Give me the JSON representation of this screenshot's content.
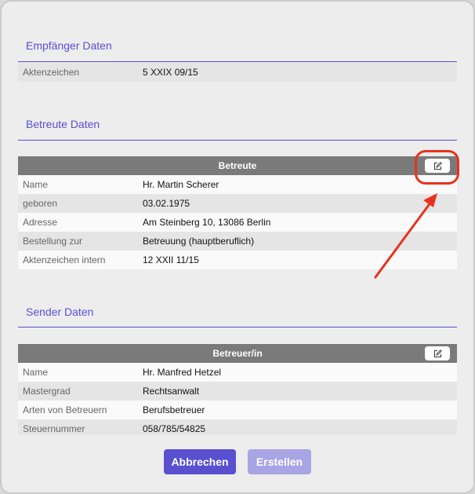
{
  "recipient": {
    "title": "Empfänger Daten",
    "rows": [
      {
        "label": "Aktenzeichen",
        "value": "5 XXIX 09/15"
      }
    ]
  },
  "ward": {
    "title": "Betreute Daten",
    "table_header": "Betreute",
    "rows": [
      {
        "label": "Name",
        "value": "Hr. Martin Scherer"
      },
      {
        "label": "geboren",
        "value": "03.02.1975"
      },
      {
        "label": "Adresse",
        "value": "Am Steinberg 10, 13086 Berlin"
      },
      {
        "label": "Bestellung zur",
        "value": "Betreuung (hauptberuflich)"
      },
      {
        "label": "Aktenzeichen intern",
        "value": "12 XXII 11/15"
      }
    ]
  },
  "sender": {
    "title": "Sender Daten",
    "table_header": "Betreuer/in",
    "rows": [
      {
        "label": "Name",
        "value": "Hr. Manfred Hetzel"
      },
      {
        "label": "Mastergrad",
        "value": "Rechtsanwalt"
      },
      {
        "label": "Arten von Betreuern",
        "value": "Berufsbetreuer"
      },
      {
        "label": "Steuernummer",
        "value": "058/785/54825"
      }
    ]
  },
  "footer": {
    "cancel_label": "Abbrechen",
    "create_label": "Erstellen"
  },
  "icons": {
    "edit": "edit-icon"
  },
  "colors": {
    "accent": "#5a4fcf",
    "accent_disabled": "#a9a4e4",
    "table_header": "#7a7a7a",
    "annotation": "#e8321d"
  }
}
